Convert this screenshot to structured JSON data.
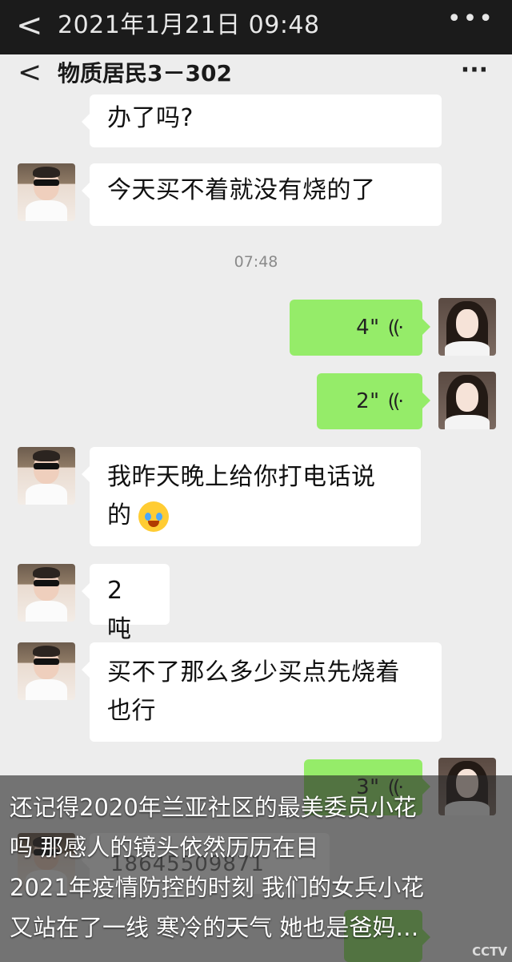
{
  "outer_bar": {
    "back_glyph": "<",
    "title": "2021年1月21日 09:48",
    "more_glyph": "•••"
  },
  "chat_header": {
    "back_glyph": "<",
    "title": "物质居民3－302",
    "more_glyph": "···"
  },
  "messages": {
    "m1_text": "办了吗?",
    "m2_text": "今天买不着就没有烧的了",
    "timestamp": "07:48",
    "voice1_duration": "4\"",
    "voice2_duration": "2\"",
    "m3_line1": "我昨天晚上给你打电话说",
    "m3_line2": "的",
    "m4_text": "2 吨",
    "m5_line1": "买不了那么多少买点先烧着",
    "m5_line2": "也行",
    "voice3_duration": "3\"",
    "phone_number": "18645509871"
  },
  "icons": {
    "voice_wave": "((·",
    "emoji": "crying-laughing-face"
  },
  "overlay": {
    "line1": "还记得2020年兰亚社区的最美委员小花",
    "line2": "吗  那感人的镜头依然历历在目",
    "line3": "2021年疫情防控的时刻  我们的女兵小花",
    "line4": "又站在了一线  寒冷的天气  她也是爸妈…"
  },
  "watermark": "CCTV"
}
